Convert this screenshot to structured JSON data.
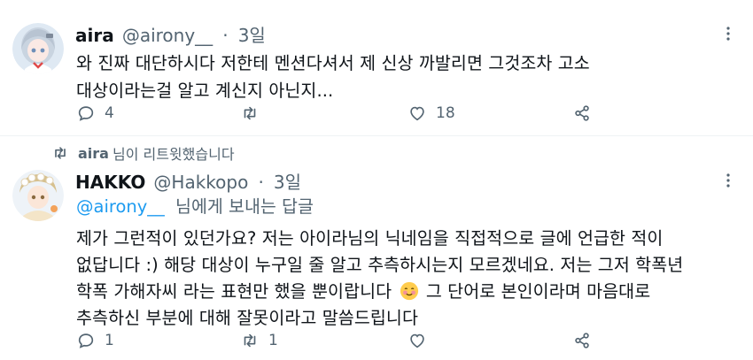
{
  "tweet1": {
    "name": "aira",
    "handle": "@airony__",
    "dot": "·",
    "time": "3일",
    "lines": [
      "와 진짜 대단하시다 저한테 멘션다셔서 제 신상 까발리면 그것조차 고소",
      "대상이라는걸 알고 계신지 아닌지..."
    ],
    "reply_count": "4",
    "retweet_count": "",
    "like_count": "18"
  },
  "retweet_notice": {
    "user": "aira",
    "text": "님이 리트윗했습니다"
  },
  "tweet2": {
    "name": "HAKKO",
    "handle": "@Hakkopo",
    "dot": "·",
    "time": "3일",
    "replying_mention": "@airony__",
    "replying_text": "님에게 보내는 답글",
    "lines": [
      "제가 그런적이 있던가요? 저는 아이라님의 닉네임을 직접적으로 글에 언급한 적이",
      "없답니다 :) 해당 대상이 누구일 줄 알고 추측하시는지 모르겠네요. 저는 그저 학폭년",
      "학폭 가해자씨 라는 표현만 했을 뿐이랍니다",
      "그 단어로 본인이라며 마음대로",
      "추측하신 부분에 대해 잘못이라고 말씀드립니다"
    ],
    "reply_count": "1",
    "retweet_count": "1",
    "like_count": ""
  },
  "icons": {
    "more": "more-vertical-icon",
    "reply": "reply-icon",
    "retweet": "retweet-icon",
    "like": "heart-icon",
    "share": "share-icon",
    "emoji": "smiling-face-emoji"
  },
  "colors": {
    "text": "#0f1419",
    "muted": "#536471",
    "accent": "#1d9bf0",
    "divider": "#eff3f4"
  }
}
